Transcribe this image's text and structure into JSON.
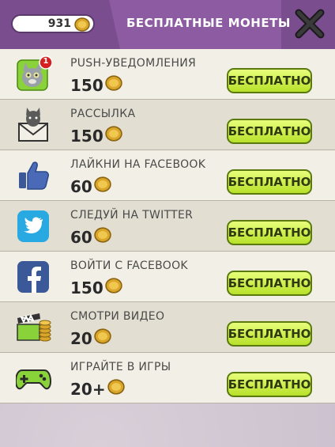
{
  "header": {
    "coins": "931",
    "title": "БЕСПЛАТНЫЕ МОНЕТЫ"
  },
  "rows": [
    {
      "title": "PUSH-УВЕДОМЛЕНИЯ",
      "amount": "150",
      "button": "БЕСПЛАТНО",
      "icon": "talking-tom-icon",
      "badge": "1"
    },
    {
      "title": "РАССЫЛКА",
      "amount": "150",
      "button": "БЕСПЛАТНО",
      "icon": "envelope-icon"
    },
    {
      "title": "ЛАЙКНИ НА FACEBOOK",
      "amount": "60",
      "button": "БЕСПЛАТНО",
      "icon": "thumbs-up-icon"
    },
    {
      "title": "СЛЕДУЙ НА TWITTER",
      "amount": "60",
      "button": "БЕСПЛАТНО",
      "icon": "twitter-icon"
    },
    {
      "title": "ВОЙТИ С FACEBOOK",
      "amount": "150",
      "button": "БЕСПЛАТНО",
      "icon": "facebook-icon"
    },
    {
      "title": "СМОТРИ ВИДЕО",
      "amount": "20",
      "button": "БЕСПЛАТНО",
      "icon": "video-clapper-icon"
    },
    {
      "title": "ИГРАЙТЕ В ИГРЫ",
      "amount": "20+",
      "button": "БЕСПЛАТНО",
      "icon": "gamepad-icon"
    }
  ],
  "colors": {
    "header_bg": "#7a4d8e",
    "button_green": "#c8ec3a",
    "row_light": "#f2f0e6",
    "row_dark": "#e2dfd2"
  }
}
